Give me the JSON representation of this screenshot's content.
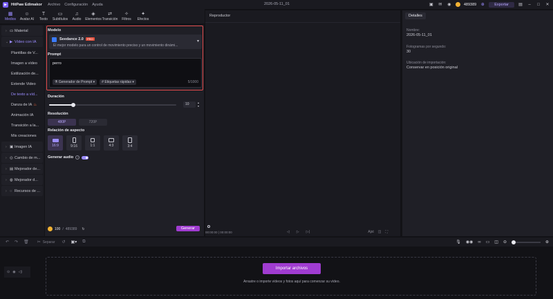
{
  "app": {
    "name": "HitPaw Edimakor",
    "document": "2026-05-11_01"
  },
  "menu": [
    "Archivo",
    "Configuración",
    "Ayuda"
  ],
  "titlebar": {
    "credits": "489389",
    "export_label": "Exportar"
  },
  "toolbar": [
    {
      "label": "Medios",
      "icon": "media-icon"
    },
    {
      "label": "Avatar AI",
      "icon": "avatar-icon"
    },
    {
      "label": "Texto",
      "icon": "text-icon"
    },
    {
      "label": "Subtítulos",
      "icon": "subtitles-icon"
    },
    {
      "label": "Audio",
      "icon": "audio-icon"
    },
    {
      "label": "Elementos",
      "icon": "elements-icon"
    },
    {
      "label": "Transición",
      "icon": "transition-icon"
    },
    {
      "label": "Filtros",
      "icon": "filters-icon"
    },
    {
      "label": "Efectos",
      "icon": "effects-icon"
    }
  ],
  "sidebar": {
    "items": [
      {
        "label": "Material",
        "type": "group"
      },
      {
        "label": "Vídeo con IA",
        "type": "group-active"
      },
      {
        "label": "Plantillas de V...",
        "type": "sub"
      },
      {
        "label": "Imagen a vídeo",
        "type": "sub"
      },
      {
        "label": "Estilización de...",
        "type": "sub"
      },
      {
        "label": "Extende Video",
        "type": "sub"
      },
      {
        "label": "De texto a víd...",
        "type": "sub-active"
      },
      {
        "label": "Danza de IA",
        "type": "sub-flame"
      },
      {
        "label": "Animación IA",
        "type": "sub"
      },
      {
        "label": "Transición a la...",
        "type": "sub"
      },
      {
        "label": "Mis creaciones",
        "type": "sub"
      },
      {
        "label": "Imagen IA",
        "type": "group"
      },
      {
        "label": "Cambio de m...",
        "type": "group"
      },
      {
        "label": "Mejorador de...",
        "type": "group"
      },
      {
        "label": "Mejorador d...",
        "type": "group"
      },
      {
        "label": "Recursos de ...",
        "type": "group"
      }
    ]
  },
  "panel": {
    "model_label": "Modelo",
    "model_name": "Seedance 2.0",
    "model_badge": "PRO",
    "model_desc": "El mejor modelo para un control de movimiento preciso y un movimiento dinámi...",
    "prompt_label": "Prompt",
    "prompt_value": "perro",
    "prompt_generator": "Generador de Prompt",
    "quick_tags": "Etiquetas rápidas",
    "prompt_counter": "5/1000",
    "duration_label": "Duración",
    "duration_value": "10",
    "duration_fraction": 0.19,
    "resolution_label": "Resolución",
    "resolutions": [
      "480P",
      "720P"
    ],
    "aspect_label": "Relación de aspecto",
    "aspects": [
      "16:9",
      "9:16",
      "1:1",
      "4:3",
      "3:4"
    ],
    "audio_label": "Generar audio",
    "cost": "100",
    "balance": "489389",
    "generate_label": "Generar"
  },
  "player": {
    "title": "Reproductor",
    "time_current": "00:00:00",
    "time_total": "00:00:00",
    "fit_label": "Ajst"
  },
  "details": {
    "tab": "Detalles",
    "name_label": "Nombre:",
    "name_value": "2026-05-11_01",
    "fps_label": "Fotogramas por segundo:",
    "fps_value": "30",
    "import_label": "Ubicación de importación:",
    "import_value": "Conservar en posición original"
  },
  "timeline_toolbar": {
    "split_label": "Separar"
  },
  "timeline": {
    "import_button": "Importar archivos",
    "drop_text": "Arrastre o importe vídeos y fotos aquí para comenzar su vídeo."
  }
}
